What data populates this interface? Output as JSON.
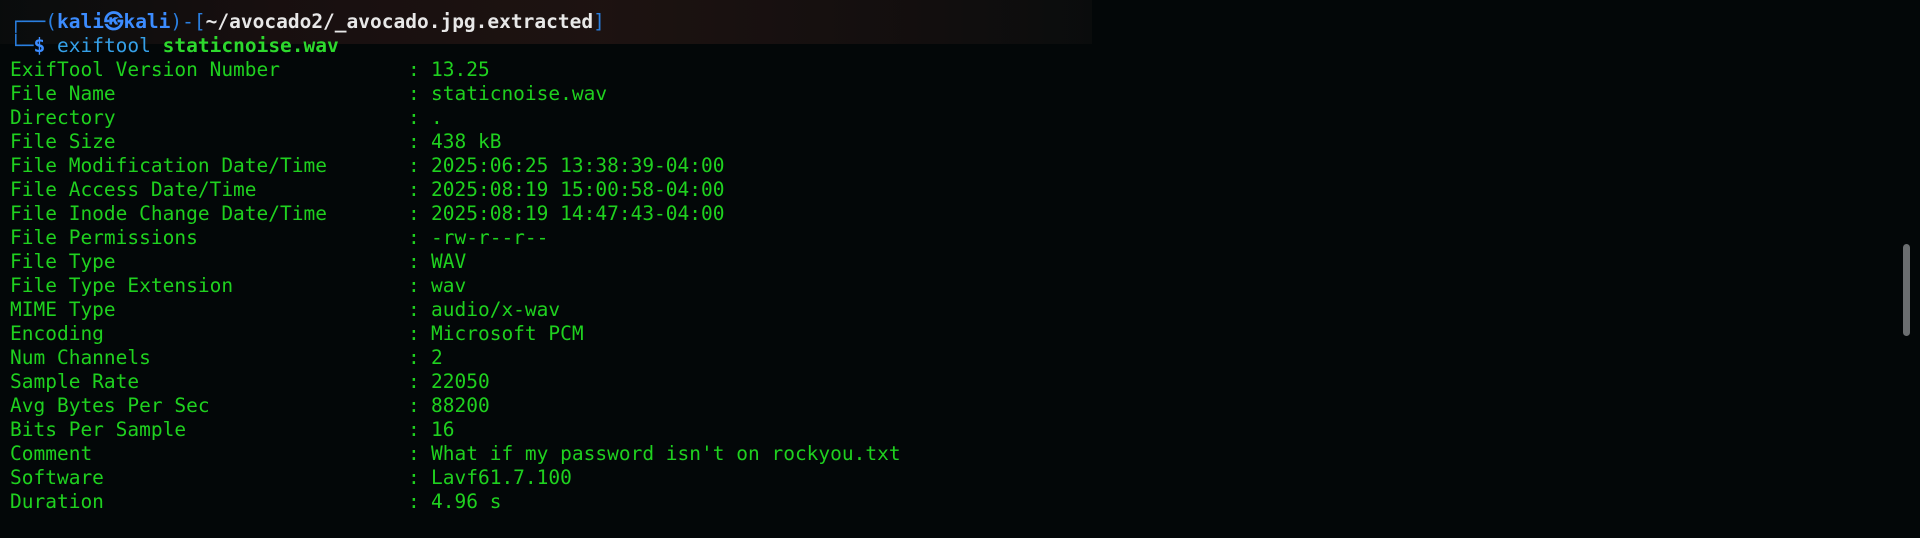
{
  "prompt": {
    "corner_top": "┌──(",
    "user": "kali",
    "skull": "㉿",
    "host": "kali",
    "mid": ")-[",
    "cwd": "~/avocado2/_avocado.jpg.extracted",
    "close": "]",
    "corner_bottom": "└─",
    "dollar": "$",
    "command": "exiftool",
    "argument": "staticnoise.wav"
  },
  "separator": ":",
  "output": [
    {
      "key": "ExifTool Version Number",
      "value": "13.25"
    },
    {
      "key": "File Name",
      "value": "staticnoise.wav"
    },
    {
      "key": "Directory",
      "value": "."
    },
    {
      "key": "File Size",
      "value": "438 kB"
    },
    {
      "key": "File Modification Date/Time",
      "value": "2025:06:25 13:38:39-04:00"
    },
    {
      "key": "File Access Date/Time",
      "value": "2025:08:19 15:00:58-04:00"
    },
    {
      "key": "File Inode Change Date/Time",
      "value": "2025:08:19 14:47:43-04:00"
    },
    {
      "key": "File Permissions",
      "value": "-rw-r--r--"
    },
    {
      "key": "File Type",
      "value": "WAV"
    },
    {
      "key": "File Type Extension",
      "value": "wav"
    },
    {
      "key": "MIME Type",
      "value": "audio/x-wav"
    },
    {
      "key": "Encoding",
      "value": "Microsoft PCM"
    },
    {
      "key": "Num Channels",
      "value": "2"
    },
    {
      "key": "Sample Rate",
      "value": "22050"
    },
    {
      "key": "Avg Bytes Per Sec",
      "value": "88200"
    },
    {
      "key": "Bits Per Sample",
      "value": "16"
    },
    {
      "key": "Comment",
      "value": "What if my password isn't on rockyou.txt"
    },
    {
      "key": "Software",
      "value": "Lavf61.7.100"
    },
    {
      "key": "Duration",
      "value": "4.96 s"
    }
  ],
  "colors": {
    "background": "#030708",
    "output_text": "#1fd11f",
    "prompt_blue": "#3c8cff",
    "path_white": "#e8e8e8"
  }
}
